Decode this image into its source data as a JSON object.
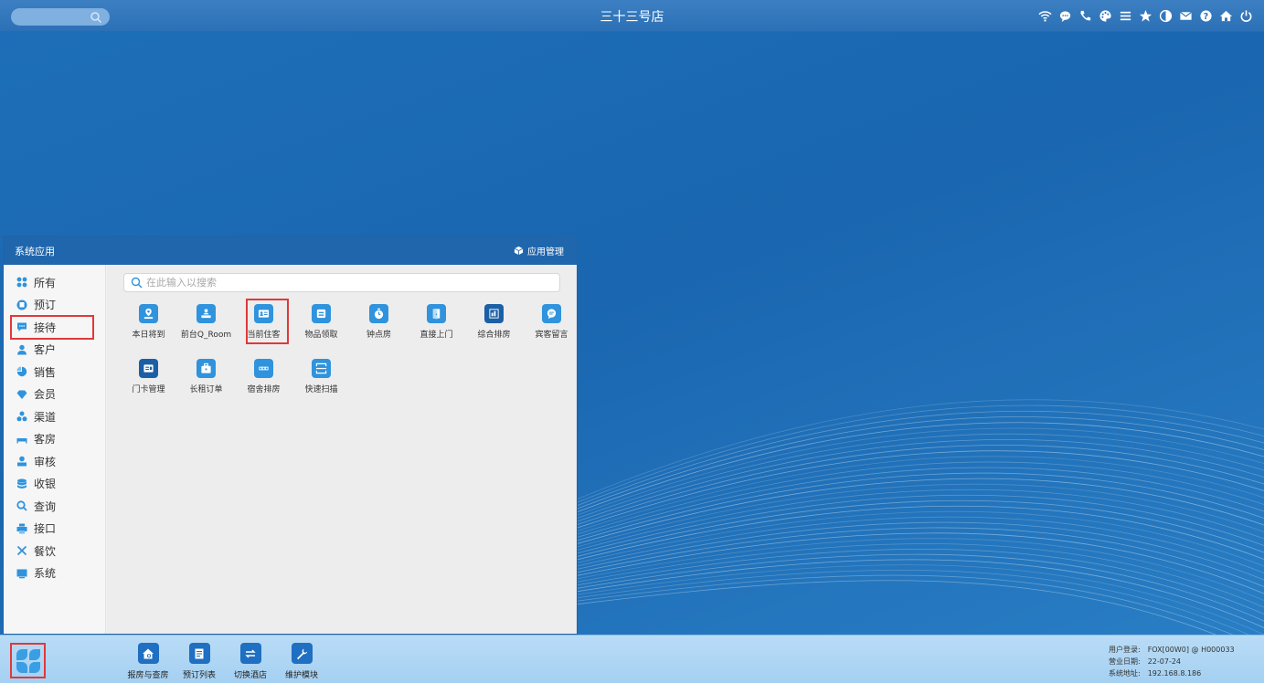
{
  "topbar": {
    "title": "三十三号店",
    "icons": [
      "wifi-icon",
      "chat-icon",
      "phone-icon",
      "palette-icon",
      "menu-icon",
      "star-icon",
      "contrast-icon",
      "mail-icon",
      "help-icon",
      "home-icon",
      "power-icon"
    ]
  },
  "window": {
    "title": "系统应用",
    "manage_label": "应用管理",
    "search_placeholder": "在此输入以搜索",
    "sidebar": [
      {
        "label": "所有",
        "icon": "grid-icon"
      },
      {
        "label": "预订",
        "icon": "bookmark-icon"
      },
      {
        "label": "接待",
        "icon": "chat-bubble-icon",
        "active": true
      },
      {
        "label": "客户",
        "icon": "person-icon"
      },
      {
        "label": "销售",
        "icon": "pie-chart-icon"
      },
      {
        "label": "会员",
        "icon": "diamond-icon"
      },
      {
        "label": "渠道",
        "icon": "cluster-icon"
      },
      {
        "label": "客房",
        "icon": "bed-icon"
      },
      {
        "label": "审核",
        "icon": "audit-icon"
      },
      {
        "label": "收银",
        "icon": "coins-icon"
      },
      {
        "label": "查询",
        "icon": "search-icon"
      },
      {
        "label": "接口",
        "icon": "printer-icon"
      },
      {
        "label": "餐饮",
        "icon": "utensils-icon"
      },
      {
        "label": "系统",
        "icon": "monitor-icon"
      }
    ],
    "apps": [
      {
        "label": "本日将到",
        "icon": "arrival-icon"
      },
      {
        "label": "前台Q_Room",
        "icon": "front-desk-icon"
      },
      {
        "label": "当前住客",
        "icon": "guest-card-icon",
        "highlighted": true
      },
      {
        "label": "物品领取",
        "icon": "box-icon"
      },
      {
        "label": "钟点房",
        "icon": "timer-icon"
      },
      {
        "label": "直接上门",
        "icon": "door-icon"
      },
      {
        "label": "综合排房",
        "icon": "room-assign-icon"
      },
      {
        "label": "宾客留言",
        "icon": "message-icon"
      },
      {
        "label": "门卡管理",
        "icon": "key-card-icon"
      },
      {
        "label": "长租订单",
        "icon": "briefcase-icon"
      },
      {
        "label": "宿舍排房",
        "icon": "dorm-icon"
      },
      {
        "label": "快速扫描",
        "icon": "scan-icon"
      }
    ]
  },
  "taskbar": {
    "apps": [
      {
        "label": "报房与查房",
        "icon": "house-search-icon"
      },
      {
        "label": "预订列表",
        "icon": "list-icon"
      },
      {
        "label": "切换酒店",
        "icon": "switch-icon"
      },
      {
        "label": "维护模块",
        "icon": "wrench-icon"
      }
    ],
    "info": [
      {
        "key": "用户登录:",
        "value": "FOX[00W0] @ H000033"
      },
      {
        "key": "营业日期:",
        "value": "22-07-24"
      },
      {
        "key": "系统地址:",
        "value": "192.168.8.186"
      }
    ]
  },
  "colors": {
    "accent": "#1f66ad",
    "app_icon": "#2f93dd",
    "highlight": "#e0393a"
  }
}
